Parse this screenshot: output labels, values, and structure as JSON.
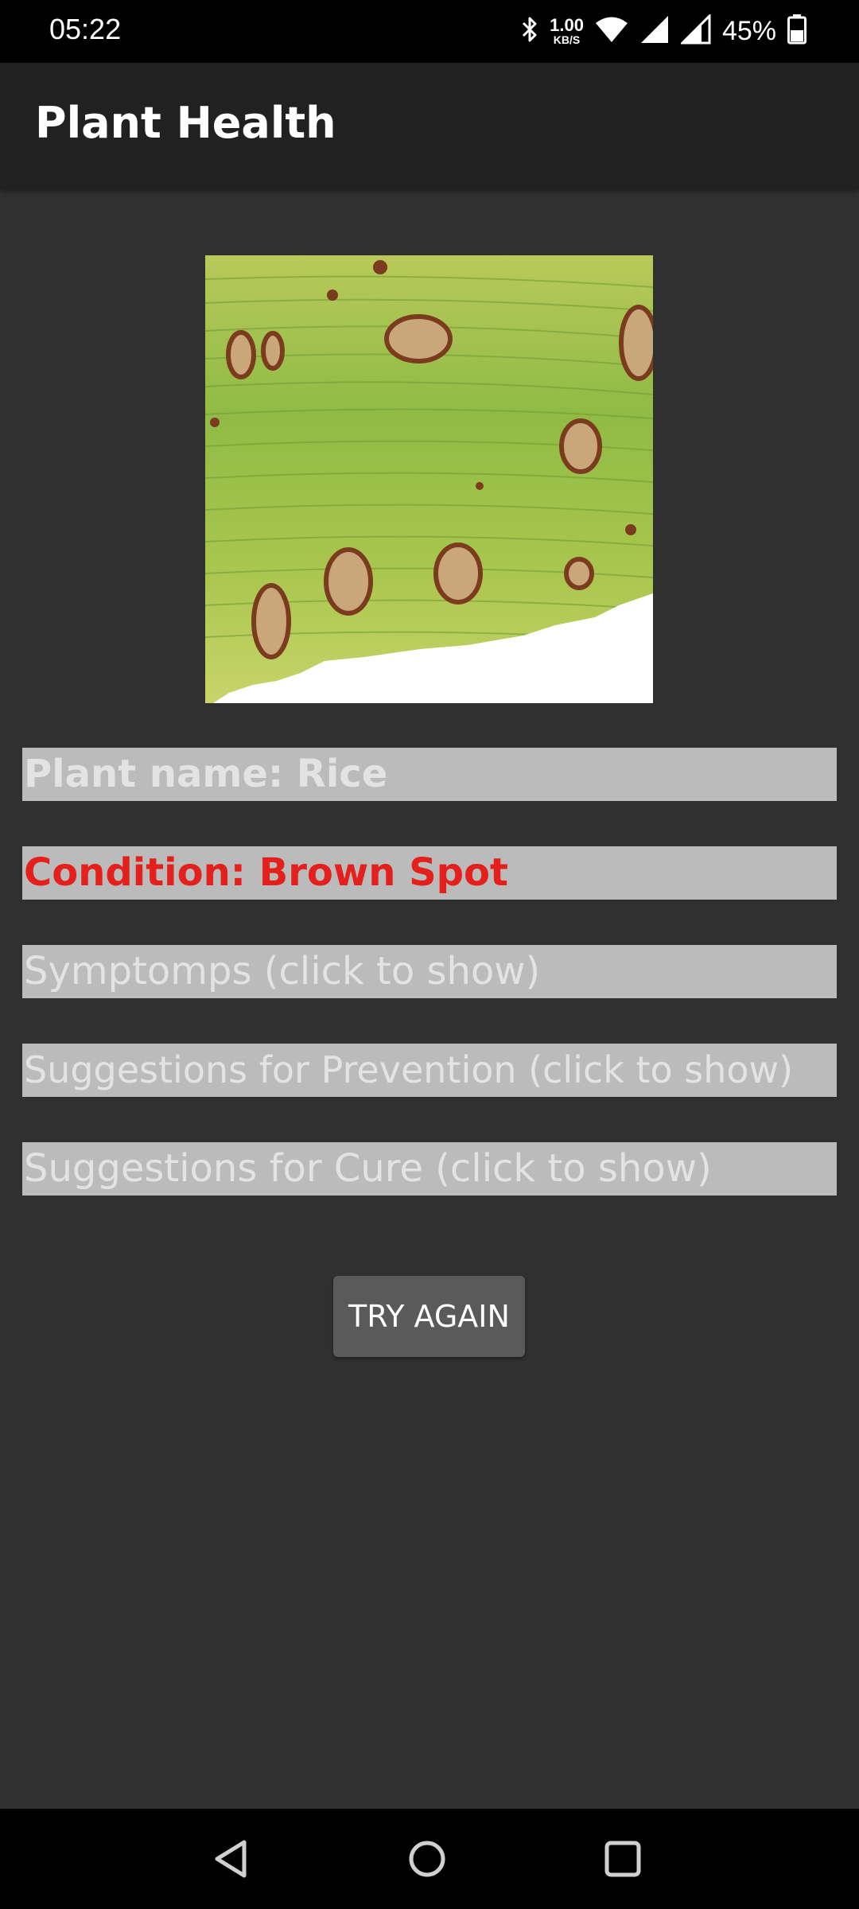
{
  "status_bar": {
    "time": "05:22",
    "net_speed_value": "1.00",
    "net_speed_unit": "KB/S",
    "battery": "45%",
    "icons": [
      "bluetooth-icon",
      "wifi-icon",
      "signal-icon",
      "signal-icon",
      "battery-icon"
    ]
  },
  "app_bar": {
    "title": "Plant Health"
  },
  "result": {
    "plant_name": "Plant name: Rice",
    "condition": "Condition: Brown Spot",
    "condition_color": "#e3201b",
    "symptoms": "Symptomps (click to show)",
    "prevention": "Suggestions for Prevention (click to show)",
    "cure": "Suggestions for Cure (click to show)"
  },
  "actions": {
    "try_again": "TRY AGAIN"
  },
  "nav_bar": {
    "icons": [
      "back-icon",
      "home-icon",
      "recents-icon"
    ]
  },
  "colors": {
    "background": "#303030",
    "app_bar": "#212121",
    "row_background": "#bbbbbb",
    "row_text": "#e3e3e3",
    "button": "#5a5a5a"
  }
}
